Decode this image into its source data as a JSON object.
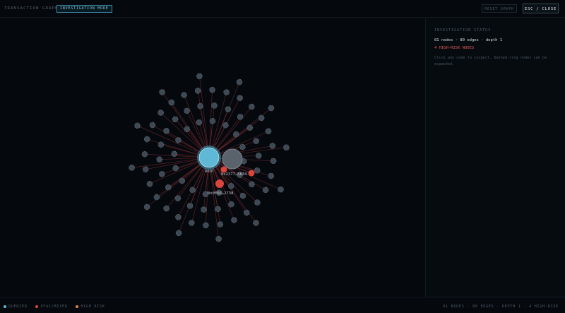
{
  "header": {
    "title": "TRANSACTION GRAPH",
    "mode_badge": "INVESTIGATION MODE",
    "reset_button": "RESET GRAPH",
    "close_button": "ESC / CLOSE"
  },
  "graph": {
    "root_label": "ROOT",
    "hub_label": "0x2377…5834",
    "risk_label": "0x0F66…2738",
    "colors": {
      "queried": "#5fb9d6",
      "ofac_mixer": "#d9463e",
      "high_risk": "#e0824a",
      "neighbor": "#3f4954",
      "edge": "#7a2a2e"
    }
  },
  "panel": {
    "heading": "INVESTIGATION STATUS",
    "stats": "81 nodes · 80 edges · depth 1",
    "high_risk": "4 HIGH-RISK NODES",
    "help": "Click any node to inspect. Dashed-ring nodes can be expanded."
  },
  "footer": {
    "legend": [
      {
        "label": "QUERIED",
        "color": "#5fb9d6"
      },
      {
        "label": "OFAC/MIXER",
        "color": "#d9463e"
      },
      {
        "label": "HIGH RISK",
        "color": "#e0824a"
      }
    ],
    "summary": "81 NODES · 80 EDGES · DEPTH 1 · 4 HIGH-RISK"
  }
}
